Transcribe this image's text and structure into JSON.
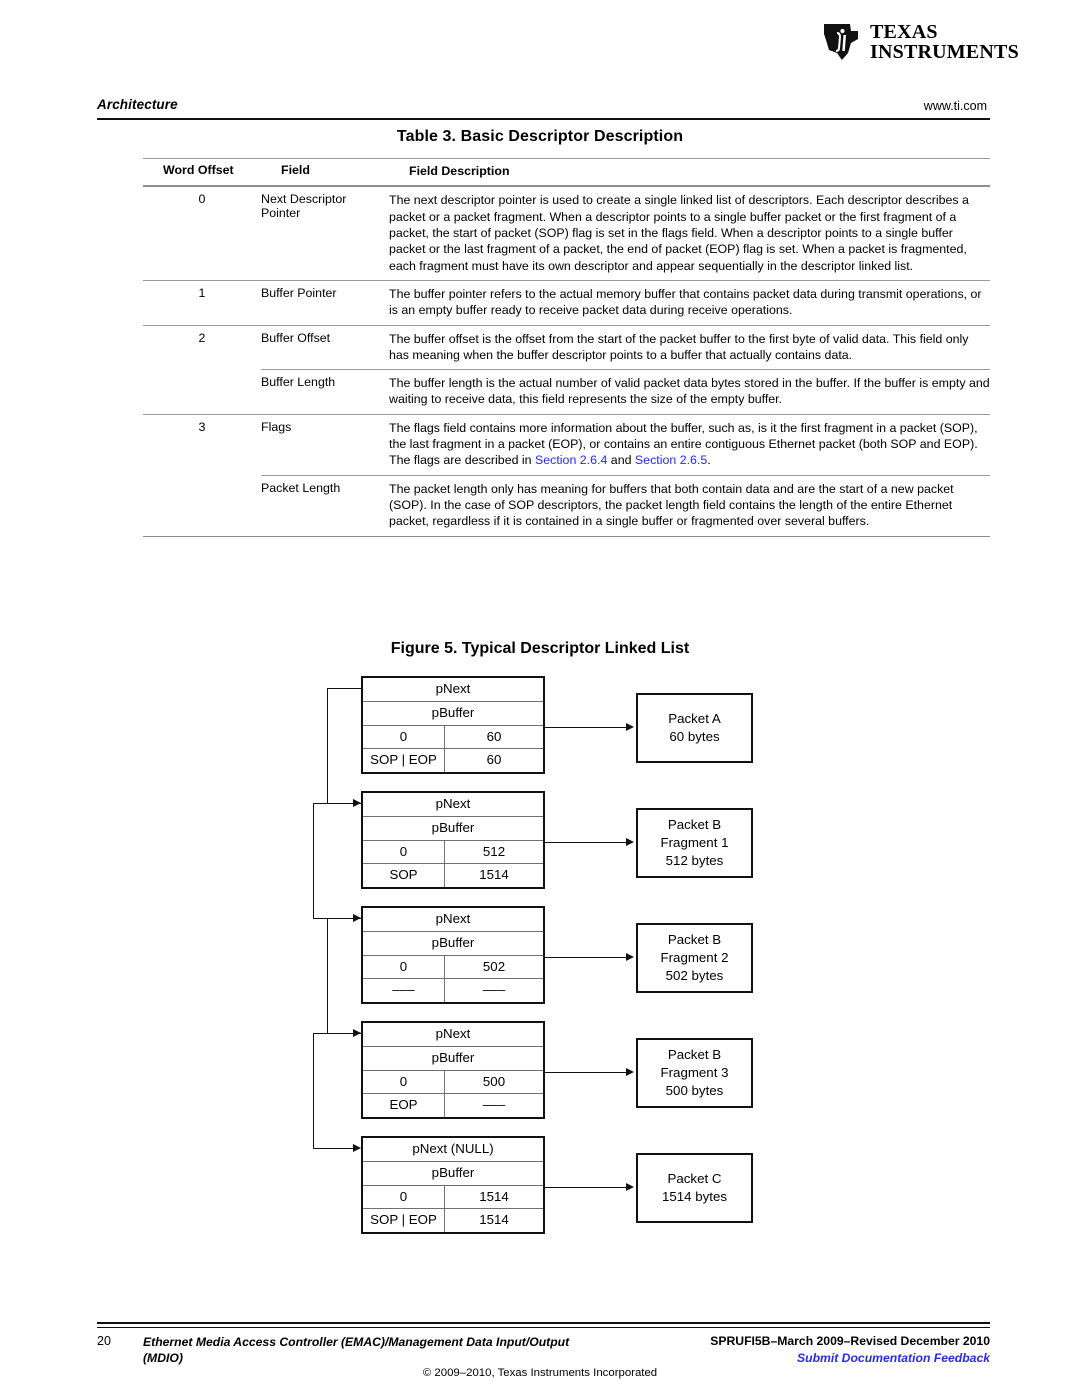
{
  "header": {
    "logo_text_line1": "TEXAS",
    "logo_text_line2": "INSTRUMENTS",
    "logo_icon": "ti-texas-logo",
    "running_head": "Architecture",
    "site": "www.ti.com"
  },
  "table": {
    "title": "Table 3. Basic Descriptor Description",
    "columns": [
      "Word Offset",
      "Field",
      "Field Description"
    ],
    "rows": [
      {
        "offset": "0",
        "field": "Next Descriptor Pointer",
        "description": "The next descriptor pointer is used to create a single linked list of descriptors. Each descriptor describes a packet or a packet fragment. When a descriptor points to a single buffer packet or the first fragment of a packet, the start of packet (SOP) flag is set in the flags field. When a descriptor points to a single buffer packet or the last fragment of a packet, the end of packet (EOP) flag is set. When a packet is fragmented, each fragment must have its own descriptor and appear sequentially in the descriptor linked list.",
        "subrow": false
      },
      {
        "offset": "1",
        "field": "Buffer Pointer",
        "description": "The buffer pointer refers to the actual memory buffer that contains packet data during transmit operations, or is an empty buffer ready to receive packet data during receive operations.",
        "subrow": false
      },
      {
        "offset": "2",
        "field": "Buffer Offset",
        "description": "The buffer offset is the offset from the start of the packet buffer to the first byte of valid data. This field only has meaning when the buffer descriptor points to a buffer that actually contains data.",
        "subrow": false
      },
      {
        "offset": "",
        "field": "Buffer Length",
        "description": "The buffer length is the actual number of valid packet data bytes stored in the buffer. If the buffer is empty and waiting to receive data, this field represents the size of the empty buffer.",
        "subrow": true
      },
      {
        "offset": "3",
        "field": "Flags",
        "description_part1": "The flags field contains more information about the buffer, such as, is it the first fragment in a packet (SOP), the last fragment in a packet (EOP), or contains an entire contiguous Ethernet packet (both SOP and EOP). The flags are described in ",
        "link1": "Section 2.6.4",
        "description_part2": " and ",
        "link2": "Section 2.6.5",
        "description_part3": ".",
        "subrow": false
      },
      {
        "offset": "",
        "field": "Packet Length",
        "description": "The packet length only has meaning for buffers that both contain data and are the start of a new packet (SOP). In the case of SOP descriptors, the packet length field contains the length of the entire Ethernet packet, regardless if it is contained in a single buffer or fragmented over several buffers.",
        "subrow": true
      }
    ]
  },
  "figure": {
    "title": "Figure 5. Typical Descriptor Linked List",
    "descriptors": [
      {
        "pnext": "pNext",
        "pbuffer": "pBuffer",
        "offset": "0",
        "length": "60",
        "flags": "SOP | EOP",
        "packet_length": "60",
        "packet": {
          "line1": "Packet A",
          "line2": "60 bytes",
          "line3": ""
        }
      },
      {
        "pnext": "pNext",
        "pbuffer": "pBuffer",
        "offset": "0",
        "length": "512",
        "flags": "SOP",
        "packet_length": "1514",
        "packet": {
          "line1": "Packet B",
          "line2": "Fragment 1",
          "line3": "512 bytes"
        }
      },
      {
        "pnext": "pNext",
        "pbuffer": "pBuffer",
        "offset": "0",
        "length": "502",
        "flags": "–––",
        "packet_length": "–––",
        "packet": {
          "line1": "Packet B",
          "line2": "Fragment 2",
          "line3": "502 bytes"
        }
      },
      {
        "pnext": "pNext",
        "pbuffer": "pBuffer",
        "offset": "0",
        "length": "500",
        "flags": "EOP",
        "packet_length": "–––",
        "packet": {
          "line1": "Packet B",
          "line2": "Fragment 3",
          "line3": "500 bytes"
        }
      },
      {
        "pnext": "pNext (NULL)",
        "pbuffer": "pBuffer",
        "offset": "0",
        "length": "1514",
        "flags": "SOP | EOP",
        "packet_length": "1514",
        "packet": {
          "line1": "Packet C",
          "line2": "1514 bytes",
          "line3": ""
        }
      }
    ]
  },
  "footer": {
    "page_number": "20",
    "doc_title": "Ethernet Media Access Controller (EMAC)/Management Data Input/Output (MDIO)",
    "doc_id": "SPRUFI5B–March 2009–Revised December 2010",
    "feedback_link": "Submit Documentation Feedback",
    "copyright": "© 2009–2010, Texas Instruments Incorporated"
  },
  "colors": {
    "link": "#2a2ae0",
    "rule": "#111111"
  }
}
